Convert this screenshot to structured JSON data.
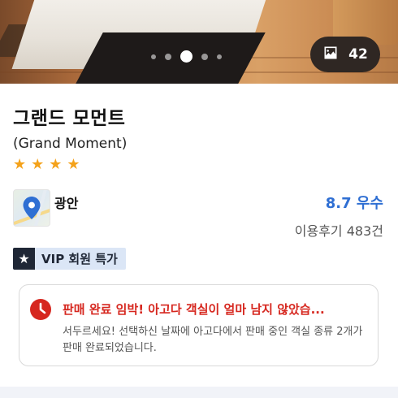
{
  "gallery": {
    "photo_count": "42",
    "photo_icon": "image-icon",
    "dots": 5,
    "active_dot": 2
  },
  "hotel": {
    "name": "그랜드 모먼트",
    "english_name": "(Grand Moment)",
    "star_rating": 4
  },
  "location": {
    "name": "광안",
    "thumbnail_icon": "map-pin-icon"
  },
  "score": {
    "rating": "8.7 우수",
    "review_count": "이용후기 483건"
  },
  "badge": {
    "label": "VIP 회원 특가",
    "icon": "star-icon"
  },
  "alert": {
    "icon": "clock-icon",
    "headline": "판매 완료 임박! 아고다 객실이 얼마 남지 않았습...",
    "body": "서두르세요! 선택하신 날짜에 아고다에서 판매 중인 객실 종류 2개가 판매 완료되었습니다."
  },
  "colors": {
    "accent_blue": "#2f6fd3",
    "alert_red": "#d6271f",
    "star_orange": "#f4a21b",
    "badge_bg": "#dbe6f6",
    "badge_dark": "#1f2736"
  }
}
